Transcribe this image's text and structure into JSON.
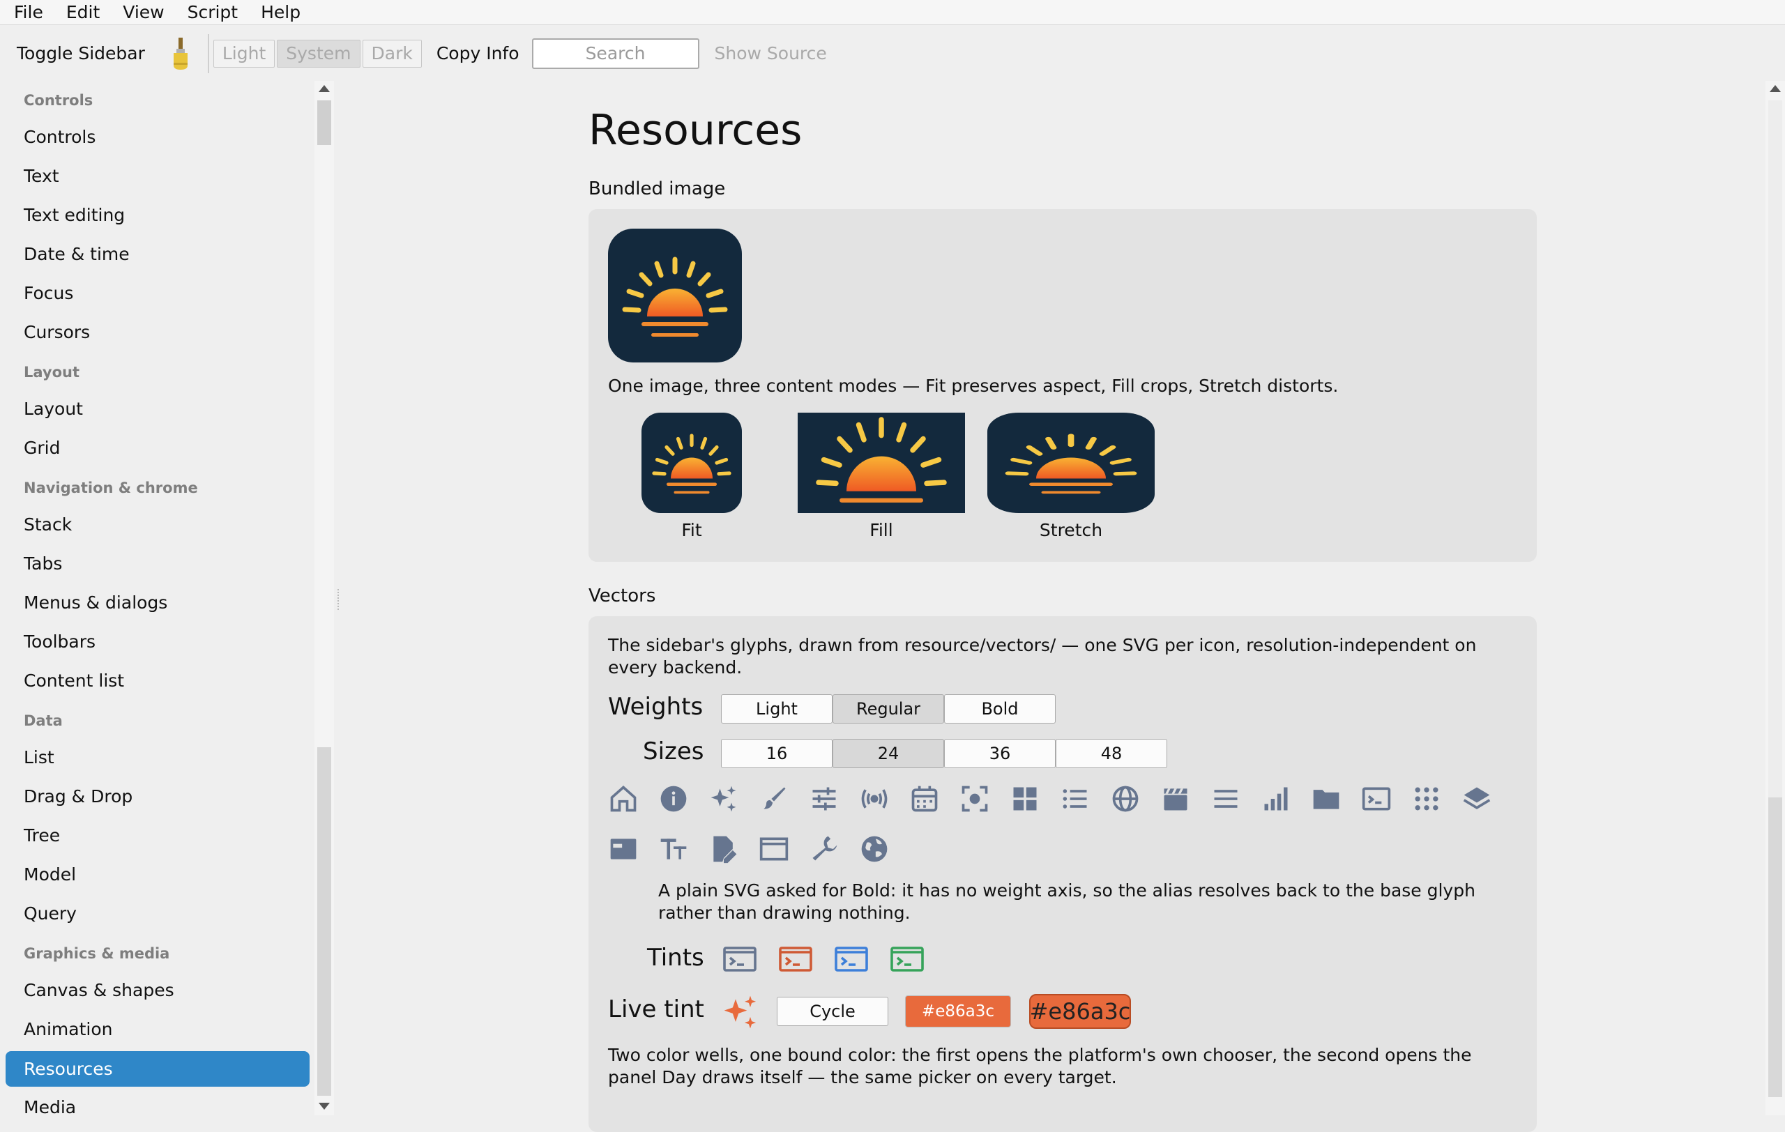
{
  "menu": [
    "File",
    "Edit",
    "View",
    "Script",
    "Help"
  ],
  "toolbar": {
    "toggle_sidebar": "Toggle Sidebar",
    "brush_icon": "paintbrush-icon",
    "appearance": [
      "Light",
      "System",
      "Dark"
    ],
    "appearance_selected": "System",
    "copy_info": "Copy Info",
    "search_placeholder": "Search",
    "show_source": "Show Source"
  },
  "sidebar": {
    "sections": [
      {
        "title": "Controls",
        "items": [
          "Controls",
          "Text",
          "Text editing",
          "Date & time",
          "Focus",
          "Cursors"
        ]
      },
      {
        "title": "Layout",
        "items": [
          "Layout",
          "Grid"
        ]
      },
      {
        "title": "Navigation & chrome",
        "items": [
          "Stack",
          "Tabs",
          "Menus & dialogs",
          "Toolbars",
          "Content list"
        ]
      },
      {
        "title": "Data",
        "items": [
          "List",
          "Drag & Drop",
          "Tree",
          "Model",
          "Query"
        ]
      },
      {
        "title": "Graphics & media",
        "items": [
          "Canvas & shapes",
          "Animation",
          "Resources",
          "Media"
        ]
      }
    ],
    "selected": "Resources"
  },
  "page": {
    "title": "Resources",
    "bundled": {
      "heading": "Bundled image",
      "description": "One image, three content modes — Fit preserves aspect, Fill crops, Stretch distorts.",
      "modes": [
        "Fit",
        "Fill",
        "Stretch"
      ]
    },
    "vectors": {
      "heading": "Vectors",
      "description_line1": "The sidebar's glyphs, drawn from resource/vectors/ — one SVG per icon, resolution-independent on",
      "description_line2": "every backend.",
      "weights_label": "Weights",
      "weights": [
        "Light",
        "Regular",
        "Bold"
      ],
      "weights_selected": "Regular",
      "sizes_label": "Sizes",
      "sizes": [
        "16",
        "24",
        "36",
        "48"
      ],
      "sizes_selected": "24",
      "icons": [
        "home-icon",
        "info-icon",
        "sparkles-icon",
        "brush-icon",
        "sliders-icon",
        "broadcast-icon",
        "calendar-icon",
        "focus-icon",
        "grid-icon",
        "list-icon",
        "globe-icon",
        "clapperboard-icon",
        "menu-lines-icon",
        "bar-chart-icon",
        "folder-icon",
        "terminal-icon",
        "dots-grid-icon",
        "layers-icon",
        "window-tab-icon",
        "text-size-icon",
        "document-edit-icon",
        "browser-window-icon",
        "wrench-icon",
        "globe-filled-icon"
      ],
      "note_line1": "A plain SVG asked for Bold: it has no weight axis, so the alias resolves back to the base glyph",
      "note_line2": "rather than drawing nothing.",
      "tints_label": "Tints",
      "tints": [
        "#66758f",
        "#cf5a35",
        "#3d7fd9",
        "#36a35a"
      ],
      "live_tint_label": "Live tint",
      "cycle": "Cycle",
      "well1": "#e86a3c",
      "well2": "#e86a3c",
      "footer_line1": "Two color wells, one bound color: the first opens the platform's own chooser, the second opens the",
      "footer_line2": "panel Day draws itself — the same picker on every target."
    }
  },
  "colors": {
    "accent": "#2f87c8",
    "icon_slate": "#66758f",
    "live_tint": "#e86a3c",
    "sun_bg": "#13293d"
  }
}
